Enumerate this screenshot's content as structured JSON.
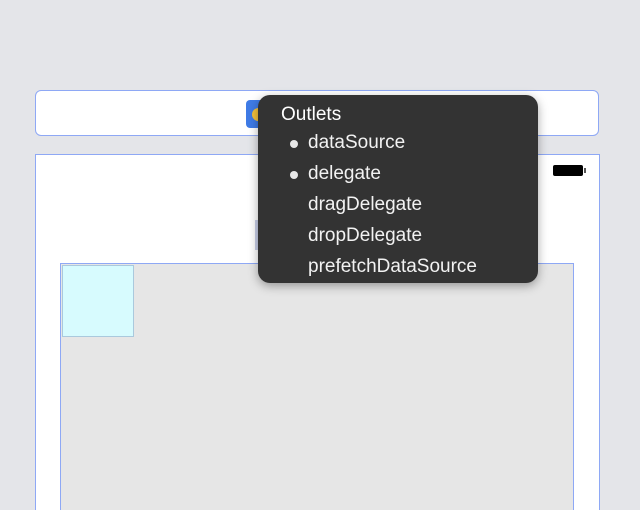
{
  "popover": {
    "title": "Outlets",
    "outlets": [
      {
        "label": "dataSource",
        "connected": true
      },
      {
        "label": "delegate",
        "connected": true
      },
      {
        "label": "dragDelegate",
        "connected": false
      },
      {
        "label": "dropDelegate",
        "connected": false
      },
      {
        "label": "prefetchDataSource",
        "connected": false
      }
    ]
  },
  "icons": {
    "dock": "view-controller-icon",
    "status": "battery-icon"
  },
  "colors": {
    "selection_border": "#8ea8f5",
    "popover_bg": "#333333",
    "cell_fill": "#d7fbfe",
    "canvas_bg": "#e4e5e9"
  }
}
